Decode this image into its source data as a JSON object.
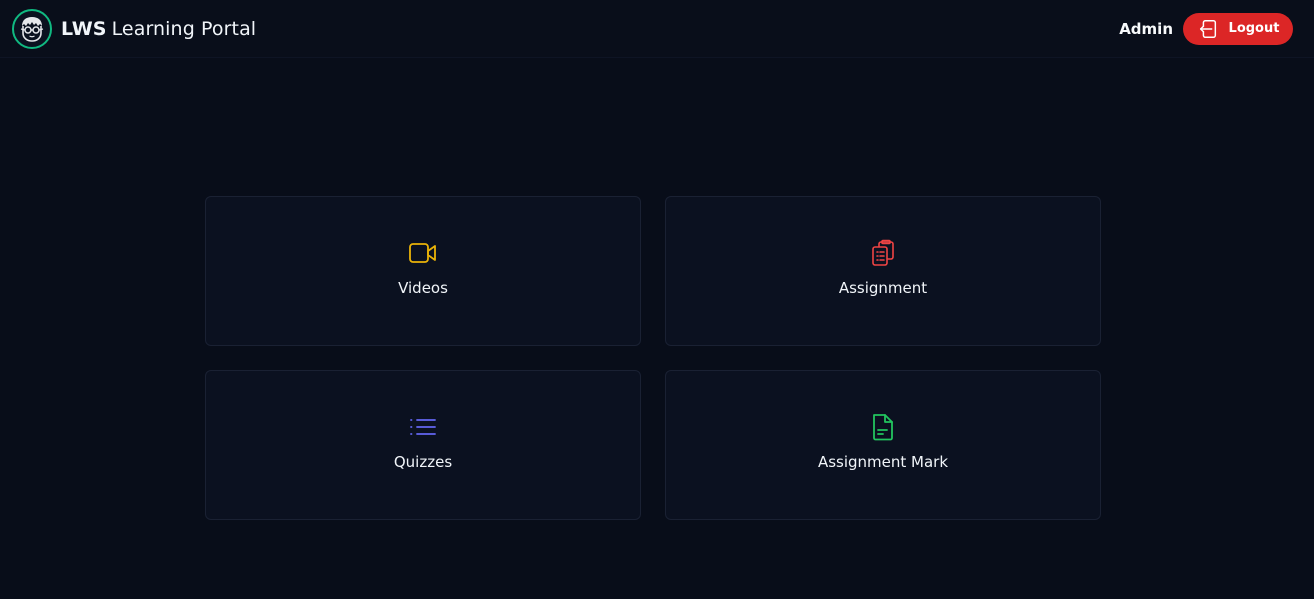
{
  "header": {
    "brand_strong": "LWS",
    "brand_rest": "Learning Portal",
    "logo_icon": "developer-avatar-icon",
    "user_name": "Admin",
    "logout_label": "Logout",
    "logout_icon": "logout-door-icon"
  },
  "colors": {
    "background": "#080d19",
    "card_background": "#0b1120",
    "logout": "#dc2626",
    "logo_ring": "#10b981"
  },
  "dashboard": {
    "cards": [
      {
        "label": "Videos",
        "icon": "video-camera-icon",
        "icon_color": "#eab308"
      },
      {
        "label": "Assignment",
        "icon": "clipboard-document-icon",
        "icon_color": "#ef4444"
      },
      {
        "label": "Quizzes",
        "icon": "list-bullet-icon",
        "icon_color": "#6366f1"
      },
      {
        "label": "Assignment Mark",
        "icon": "document-text-icon",
        "icon_color": "#22c55e"
      }
    ]
  }
}
